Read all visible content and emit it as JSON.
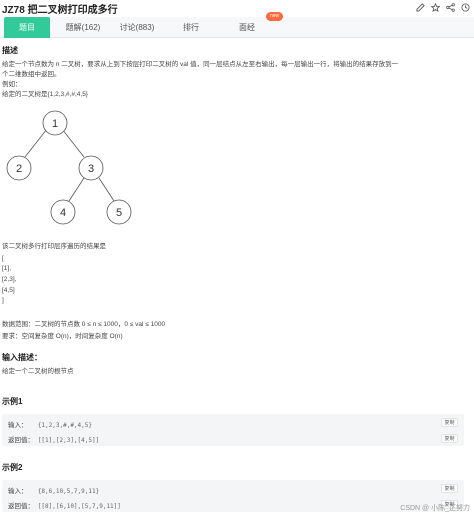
{
  "header": {
    "title": "JZ78  把二叉树打印成多行"
  },
  "tabs": [
    {
      "label": "题目"
    },
    {
      "label": "题解(162)"
    },
    {
      "label": "讨论(883)"
    },
    {
      "label": "排行"
    },
    {
      "label": "面经"
    }
  ],
  "tab_badge": "new",
  "description": {
    "heading": "描述",
    "line1": "给定一个节点数为 n 二叉树，要求从上到下按层打印二叉树的 val 值，同一层结点从左至右输出，每一层输出一行，将输出的结果存放到一",
    "line2": "个二维数组中返回。",
    "example_label": "例如：",
    "example_tree": "给定的二叉树是{1,2,3,#,#,4,5}"
  },
  "tree_nodes": [
    "1",
    "2",
    "3",
    "4",
    "5"
  ],
  "result": {
    "intro": "该二叉树多行打印层序遍历的结果是",
    "lines": [
      "[",
      "[1],",
      "[2,3],",
      "[4,5]",
      "]"
    ]
  },
  "constraints": {
    "range": "数据范围：二叉树的节点数 0 ≤ n ≤ 1000，0 ≤ val ≤ 1000",
    "complexity": "要求：空间复杂度 O(n)，时间复杂度 O(n)"
  },
  "input_desc": {
    "heading": "输入描述：",
    "text": "给定一个二叉树的根节点"
  },
  "examples": [
    {
      "heading": "示例1",
      "input_label": "输入：",
      "input_value": "{1,2,3,#,#,4,5}",
      "output_label": "返回值：",
      "output_value": "[[1],[2,3],[4,5]]",
      "copy_label": "复制"
    },
    {
      "heading": "示例2",
      "input_label": "输入：",
      "input_value": "{8,6,10,5,7,9,11}",
      "output_label": "返回值：",
      "output_value": "[[8],[6,10],[5,7,9,11]]",
      "copy_label": "复制"
    }
  ],
  "watermark": "CSDN @ 小陈_正努力"
}
